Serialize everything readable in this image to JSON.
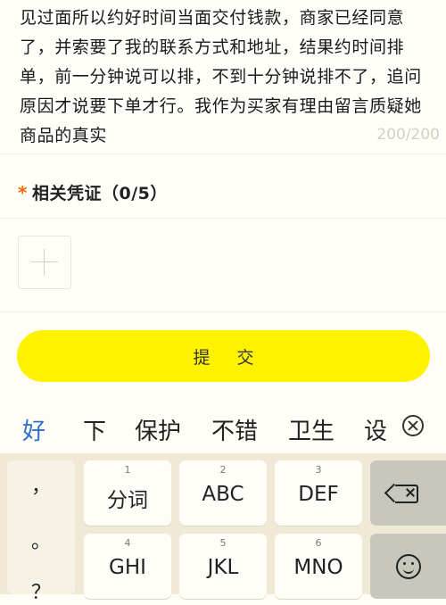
{
  "description": {
    "text": "见过面所以约好时间当面交付钱款，商家已经同意了，并索要了我的联系方式和地址，结果约时间排单，前一分钟说可以排，不到十分钟说排不了，追问原因才说要下单才行。我作为买家有理由留言质疑她商品的真实",
    "char_count": "200/200"
  },
  "evidence": {
    "required_mark": "*",
    "title": "相关凭证（0/5）"
  },
  "submit": {
    "label": "提 交"
  },
  "candidates": [
    "好",
    "下",
    "保护",
    "不错",
    "卫生",
    "设"
  ],
  "keyboard": {
    "punctuation": [
      "，",
      "。",
      "？"
    ],
    "keys": [
      {
        "num": "1",
        "label": "分词"
      },
      {
        "num": "2",
        "label": "ABC"
      },
      {
        "num": "3",
        "label": "DEF"
      },
      {
        "num": "4",
        "label": "GHI"
      },
      {
        "num": "5",
        "label": "JKL"
      },
      {
        "num": "6",
        "label": "MNO"
      }
    ]
  },
  "colors": {
    "accent": "#fff200",
    "required": "#f06a00",
    "selected_candidate": "#2b6fd1"
  }
}
